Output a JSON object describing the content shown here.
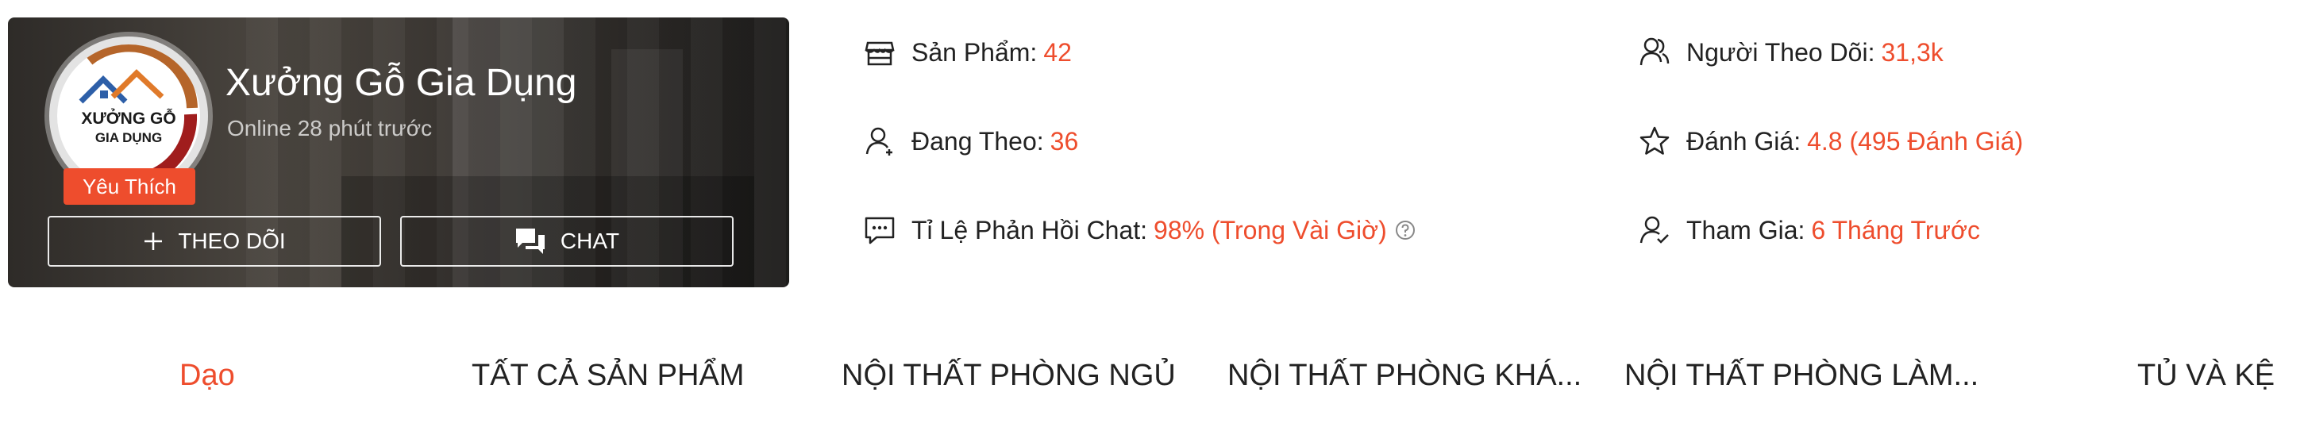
{
  "shop": {
    "name": "Xưởng Gỗ Gia Dụng",
    "online_status": "Online 28 phút trước",
    "badge": "Yêu Thích",
    "logo_line1": "XƯỞNG GỖ",
    "logo_line2": "GIA DỤNG",
    "follow_label": "THEO DÕI",
    "chat_label": "CHAT"
  },
  "stats": {
    "products": {
      "label": "Sản Phẩm:",
      "value": "42",
      "icon": "store-icon"
    },
    "following": {
      "label": "Đang Theo:",
      "value": "36",
      "icon": "user-plus-icon"
    },
    "chat_response": {
      "label": "Tỉ Lệ Phản Hồi Chat:",
      "value": "98% (Trong Vài Giờ)",
      "icon": "chat-bubble-icon"
    },
    "followers": {
      "label": "Người Theo Dõi:",
      "value": "31,3k",
      "icon": "followers-icon"
    },
    "rating": {
      "label": "Đánh Giá:",
      "value": "4.8 (495 Đánh Giá)",
      "icon": "star-icon"
    },
    "joined": {
      "label": "Tham Gia:",
      "value": "6 Tháng Trước",
      "icon": "user-check-icon"
    }
  },
  "tabs": [
    {
      "label": "Dạo",
      "active": true
    },
    {
      "label": "TẤT CẢ SẢN PHẨM",
      "active": false
    },
    {
      "label": "NỘI THẤT PHÒNG NGỦ",
      "active": false
    },
    {
      "label": "NỘI THẤT PHÒNG KHÁ...",
      "active": false
    },
    {
      "label": "NỘI THẤT PHÒNG LÀM...",
      "active": false
    },
    {
      "label": "TỦ VÀ KỆ",
      "active": false
    }
  ],
  "colors": {
    "accent": "#ee4d2d",
    "card_bg": "#3a3632",
    "text": "#222222"
  }
}
